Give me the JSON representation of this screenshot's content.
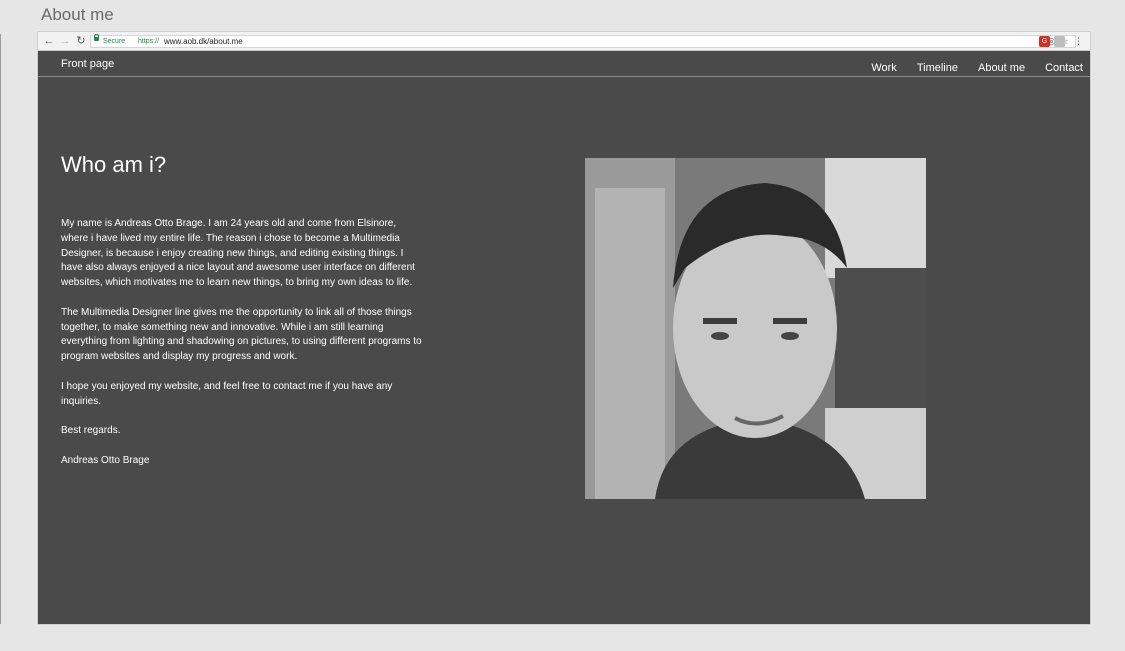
{
  "page": {
    "caption": "About me"
  },
  "browser": {
    "secure_label": "Secure",
    "url_scheme": "https://",
    "url_rest": "www.aob.dk/about.me"
  },
  "nav": {
    "brand": "Front page",
    "links": [
      "Work",
      "Timeline",
      "About me",
      "Contact"
    ]
  },
  "content": {
    "heading": "Who am i?",
    "paragraphs": [
      "My name is Andreas Otto Brage. I am 24 years old and come from Elsinore, where i have lived my entire life. The reason i chose to become a Multimedia Designer, is because i enjoy creating new things, and editing existing things. I have also always enjoyed a nice layout and awesome user interface on different websites, which motivates me to learn new things, to bring my own ideas to life.",
      "The Multimedia Designer line gives me the opportunity to link all of those things together, to make something new and innovative. While i am still learning everything from lighting and shadowing on pictures, to using different programs to program websites and display my progress and work.",
      "I hope you enjoyed my website, and feel free to contact me if you have any inquiries.",
      "Best regards.",
      "Andreas Otto Brage"
    ]
  },
  "colors": {
    "page_background": "#4a4a4a",
    "text": "#ffffff",
    "secure_green": "#1e8e3e"
  },
  "icons": [
    "back-icon",
    "forward-icon",
    "reload-icon",
    "lock-icon",
    "location-icon",
    "star-icon",
    "extension-icon",
    "menu-icon"
  ]
}
